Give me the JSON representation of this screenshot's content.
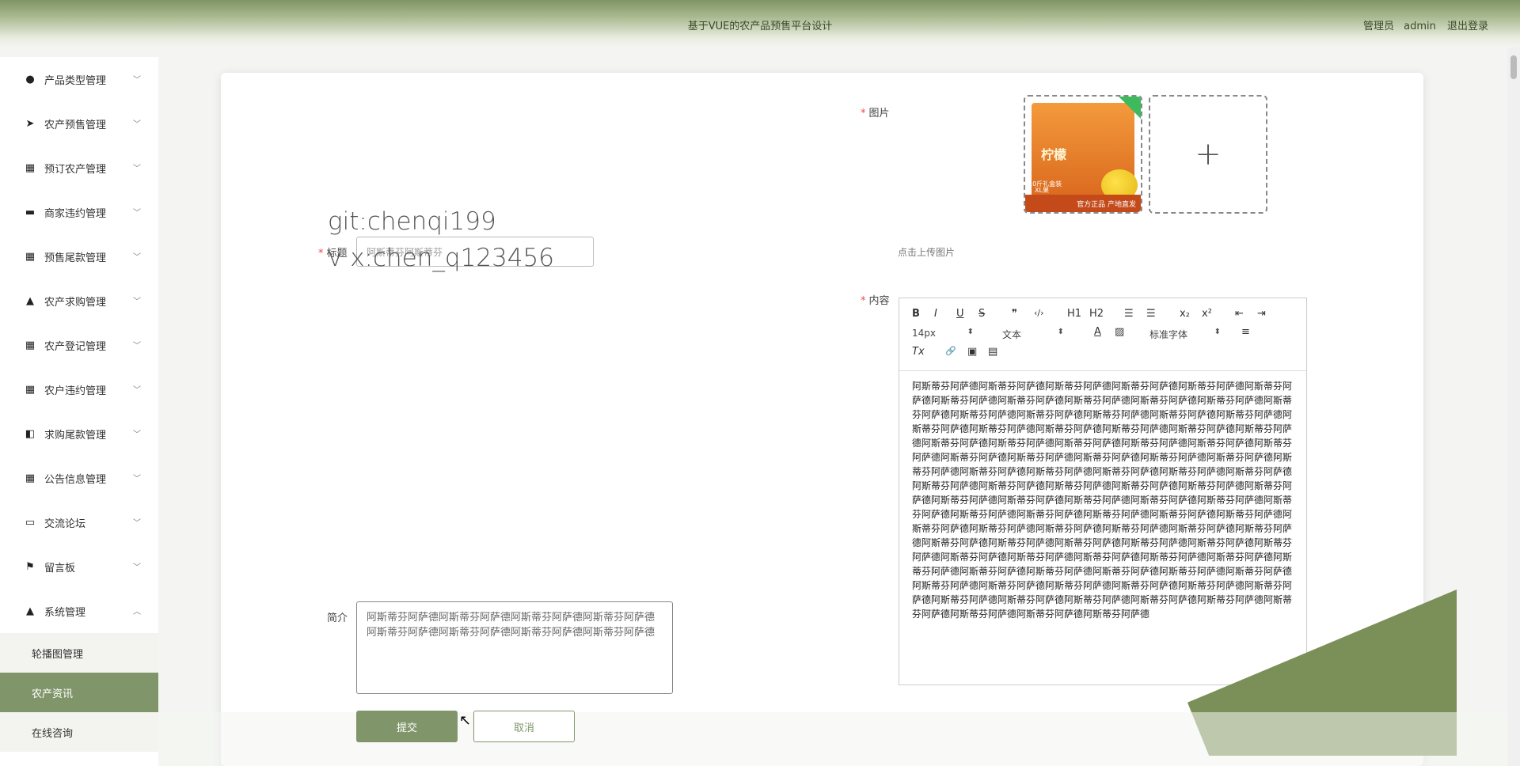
{
  "header": {
    "title": "基于VUE的农产品预售平台设计",
    "role": "管理员",
    "username": "admin",
    "logout": "退出登录"
  },
  "sidebar": {
    "items": [
      {
        "label": "产品类型管理",
        "icon": "pin-icon"
      },
      {
        "label": "农产预售管理",
        "icon": "send-icon"
      },
      {
        "label": "预订农产管理",
        "icon": "grid-icon"
      },
      {
        "label": "商家违约管理",
        "icon": "laptop-icon"
      },
      {
        "label": "预售尾款管理",
        "icon": "grid-icon"
      },
      {
        "label": "农产求购管理",
        "icon": "person-icon"
      },
      {
        "label": "农产登记管理",
        "icon": "grid-icon"
      },
      {
        "label": "农户违约管理",
        "icon": "grid-icon"
      },
      {
        "label": "求购尾款管理",
        "icon": "wallet-icon"
      },
      {
        "label": "公告信息管理",
        "icon": "grid-icon"
      },
      {
        "label": "交流论坛",
        "icon": "chat-icon"
      },
      {
        "label": "留言板",
        "icon": "flag-icon"
      },
      {
        "label": "系统管理",
        "icon": "person-icon"
      }
    ],
    "subitems": [
      "轮播图管理",
      "农产资讯",
      "在线咨询"
    ]
  },
  "form": {
    "title_label": "标题",
    "title_value": "阿斯蒂芬阿斯蒂芬",
    "image_label": "图片",
    "upload_hint": "点击上传图片",
    "image_texts": [
      "柠檬",
      "10斤礼盒装",
      "XL果",
      "官方正品 产地直发"
    ],
    "content_label": "内容",
    "intro_label": "简介",
    "intro_value": "阿斯蒂芬阿萨德阿斯蒂芬阿萨德阿斯蒂芬阿萨德阿斯蒂芬阿萨德阿斯蒂芬阿萨德阿斯蒂芬阿萨德阿斯蒂芬阿萨德阿斯蒂芬阿萨德",
    "submit": "提交",
    "cancel": "取消"
  },
  "editor": {
    "toolbar": {
      "bold": "B",
      "italic": "I",
      "underline": "U",
      "strike": "S",
      "quote": "❞",
      "code": "‹/›",
      "h1": "H1",
      "h2": "H2",
      "ol": "☰",
      "ul": "☰",
      "sub": "x₂",
      "sup": "x²",
      "outdent": "⇤",
      "indent": "⇥",
      "size": "14px",
      "block": "文本",
      "color": "A",
      "bg": "▨",
      "font": "标准字体",
      "align": "≡",
      "clean": "Tx",
      "link": "🔗",
      "image": "▣",
      "video": "▤"
    },
    "content": "阿斯蒂芬阿萨德阿斯蒂芬阿萨德阿斯蒂芬阿萨德阿斯蒂芬阿萨德阿斯蒂芬阿萨德阿斯蒂芬阿萨德阿斯蒂芬阿萨德阿斯蒂芬阿萨德阿斯蒂芬阿萨德阿斯蒂芬阿萨德阿斯蒂芬阿萨德阿斯蒂芬阿萨德阿斯蒂芬阿萨德阿斯蒂芬阿萨德阿斯蒂芬阿萨德阿斯蒂芬阿萨德阿斯蒂芬阿萨德阿斯蒂芬阿萨德阿斯蒂芬阿萨德阿斯蒂芬阿萨德阿斯蒂芬阿萨德阿斯蒂芬阿萨德阿斯蒂芬阿萨德阿斯蒂芬阿萨德阿斯蒂芬阿萨德阿斯蒂芬阿萨德阿斯蒂芬阿萨德阿斯蒂芬阿萨德阿斯蒂芬阿萨德阿斯蒂芬阿萨德阿斯蒂芬阿萨德阿斯蒂芬阿萨德阿斯蒂芬阿萨德阿斯蒂芬阿萨德阿斯蒂芬阿萨德阿斯蒂芬阿萨德阿斯蒂芬阿萨德阿斯蒂芬阿萨德阿斯蒂芬阿萨德阿斯蒂芬阿萨德阿斯蒂芬阿萨德阿斯蒂芬阿萨德阿斯蒂芬阿萨德阿斯蒂芬阿萨德阿斯蒂芬阿萨德阿斯蒂芬阿萨德阿斯蒂芬阿萨德阿斯蒂芬阿萨德阿斯蒂芬阿萨德阿斯蒂芬阿萨德阿斯蒂芬阿萨德阿斯蒂芬阿萨德阿斯蒂芬阿萨德阿斯蒂芬阿萨德阿斯蒂芬阿萨德阿斯蒂芬阿萨德阿斯蒂芬阿萨德阿斯蒂芬阿萨德阿斯蒂芬阿萨德阿斯蒂芬阿萨德阿斯蒂芬阿萨德阿斯蒂芬阿萨德阿斯蒂芬阿萨德阿斯蒂芬阿萨德阿斯蒂芬阿萨德阿斯蒂芬阿萨德阿斯蒂芬阿萨德阿斯蒂芬阿萨德阿斯蒂芬阿萨德阿斯蒂芬阿萨德阿斯蒂芬阿萨德阿斯蒂芬阿萨德阿斯蒂芬阿萨德阿斯蒂芬阿萨德阿斯蒂芬阿萨德阿斯蒂芬阿萨德阿斯蒂芬阿萨德阿斯蒂芬阿萨德阿斯蒂芬阿萨德阿斯蒂芬阿萨德阿斯蒂芬阿萨德阿斯蒂芬阿萨德阿斯蒂芬阿萨德阿斯蒂芬阿萨德阿斯蒂芬阿萨德阿斯蒂芬阿萨德阿斯蒂芬阿萨德阿斯蒂芬阿萨德阿斯蒂芬阿萨德阿斯蒂芬阿萨德阿斯蒂芬阿萨德阿斯蒂芬阿萨德阿斯蒂芬阿萨德阿斯蒂芬阿萨德阿斯蒂芬阿萨德"
  },
  "watermark": {
    "line1": "git:chenqi199",
    "line2": "v x:chen_q123456"
  },
  "colors": {
    "accent": "#80966a",
    "required": "#e64b4b",
    "deco": "#7b9058"
  }
}
